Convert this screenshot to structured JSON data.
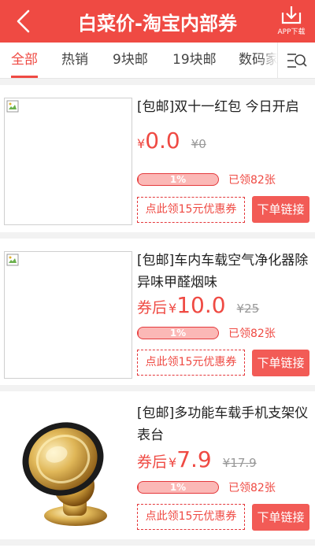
{
  "header": {
    "title": "白菜价-淘宝内部券",
    "app_download_label": "APP下载",
    "back_icon": "chevron-left-icon",
    "download_icon": "download-icon"
  },
  "tabs": {
    "items": [
      {
        "label": "全部",
        "active": true
      },
      {
        "label": "热销",
        "active": false
      },
      {
        "label": "9块邮",
        "active": false
      },
      {
        "label": "19块邮",
        "active": false
      },
      {
        "label": "数码家",
        "active": false
      }
    ],
    "menu_icon": "list-search-icon"
  },
  "products": [
    {
      "title": "[包邮]双十一红包 今日开启",
      "price_prefix": "",
      "currency": "¥",
      "price": "0.0",
      "original_price": "¥0",
      "progress_text": "1%",
      "progress_fraction": 0.01,
      "claimed": "已领82张",
      "coupon_label": "点此领15元优惠券",
      "order_label": "下单链接",
      "image": "broken-image"
    },
    {
      "title": "[包邮]车内车载空气净化器除异味甲醛烟味",
      "price_prefix": "券后",
      "currency": "¥",
      "price": "10.0",
      "original_price": "¥25",
      "progress_text": "1%",
      "progress_fraction": 0.01,
      "claimed": "已领82张",
      "coupon_label": "点此领15元优惠券",
      "order_label": "下单链接",
      "image": "broken-image"
    },
    {
      "title": "[包邮]多功能车载手机支架仪表台",
      "price_prefix": "券后",
      "currency": "¥",
      "price": "7.9",
      "original_price": "¥17.9",
      "progress_text": "1%",
      "progress_fraction": 0.01,
      "claimed": "已领82张",
      "coupon_label": "点此领15元优惠券",
      "order_label": "下单链接",
      "image": "phone-holder-photo"
    }
  ],
  "colors": {
    "brand": "#ef4a43",
    "order_button": "#f25b56",
    "progress_track": "#fbb8b6"
  }
}
